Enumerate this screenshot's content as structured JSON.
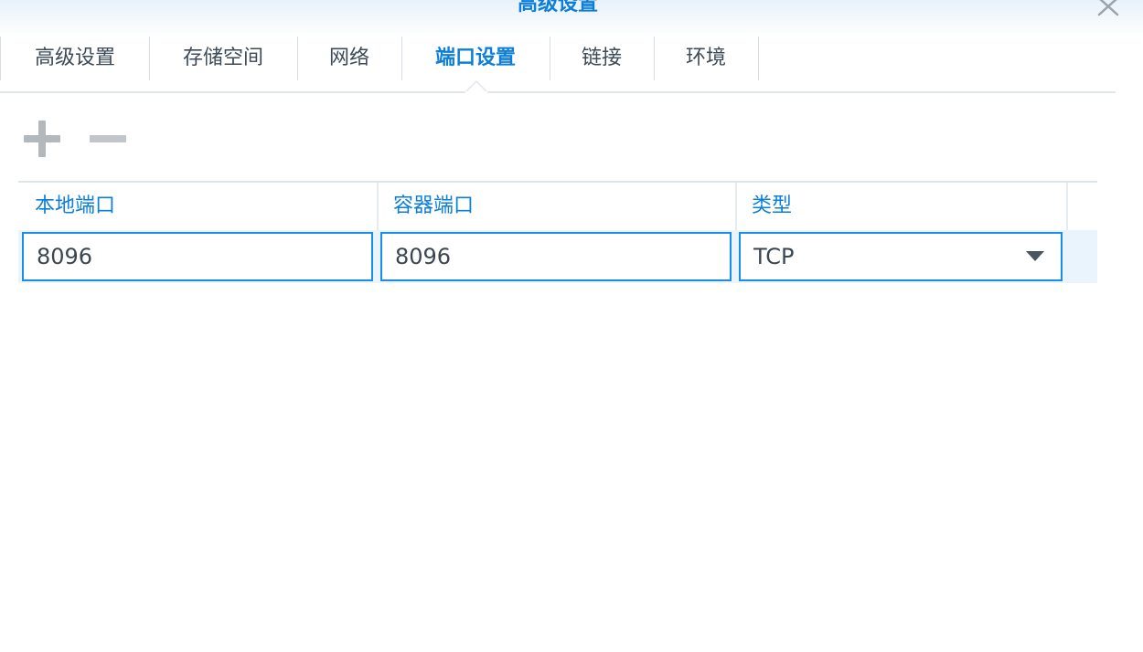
{
  "window": {
    "title": "高级设置"
  },
  "tabs": [
    {
      "label": "高级设置",
      "active": false
    },
    {
      "label": "存储空间",
      "active": false
    },
    {
      "label": "网络",
      "active": false
    },
    {
      "label": "端口设置",
      "active": true
    },
    {
      "label": "链接",
      "active": false
    },
    {
      "label": "环境",
      "active": false
    }
  ],
  "toolbar": {
    "add_icon": "plus-icon",
    "remove_icon": "minus-icon"
  },
  "port_table": {
    "columns": [
      "本地端口",
      "容器端口",
      "类型"
    ],
    "rows": [
      {
        "local_port": "8096",
        "container_port": "8096",
        "type": "TCP"
      }
    ]
  },
  "colors": {
    "accent": "#0d7fd9",
    "input_border": "#1a8cec",
    "row_highlight": "#e9f4fd",
    "text": "#3d4a57"
  }
}
